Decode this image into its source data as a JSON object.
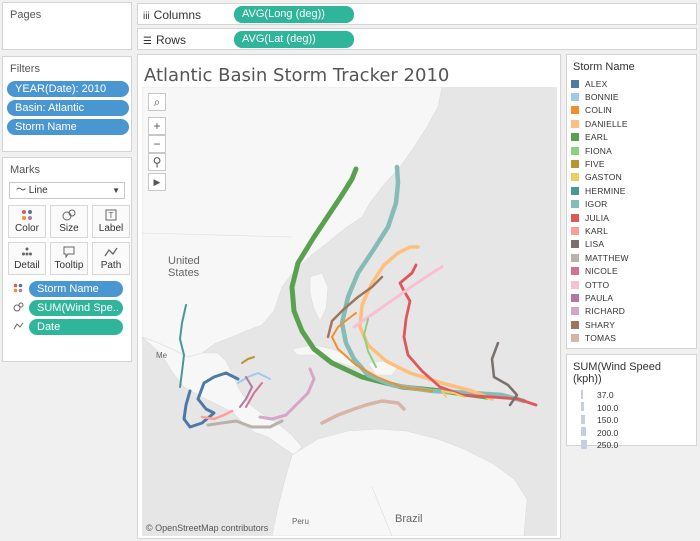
{
  "pages": {
    "title": "Pages"
  },
  "filters": {
    "title": "Filters",
    "items": [
      "YEAR(Date): 2010",
      "Basin: Atlantic",
      "Storm Name"
    ]
  },
  "marks": {
    "title": "Marks",
    "mark_type": "Line",
    "buttons": {
      "color": "Color",
      "size": "Size",
      "label": "Label",
      "detail": "Detail",
      "tooltip": "Tooltip",
      "path": "Path"
    },
    "fields": [
      "Storm Name",
      "SUM(Wind Spe..",
      "Date"
    ]
  },
  "shelves": {
    "columns_label": "Columns",
    "columns_pill": "AVG(Long (deg))",
    "rows_label": "Rows",
    "rows_pill": "AVG(Lat (deg))"
  },
  "view": {
    "title": "Atlantic Basin Storm Tracker 2010",
    "map_labels": {
      "us": "United States",
      "mexico": "Me",
      "peru": "Peru",
      "brazil": "Brazil"
    },
    "attribution": "© OpenStreetMap contributors"
  },
  "legend": {
    "title": "Storm Name",
    "items": [
      {
        "name": "ALEX",
        "color": "#4e79a7"
      },
      {
        "name": "BONNIE",
        "color": "#a0cbe8"
      },
      {
        "name": "COLIN",
        "color": "#f28e2b"
      },
      {
        "name": "DANIELLE",
        "color": "#ffbe7d"
      },
      {
        "name": "EARL",
        "color": "#59a14f"
      },
      {
        "name": "FIONA",
        "color": "#8cd17d"
      },
      {
        "name": "FIVE",
        "color": "#b6992d"
      },
      {
        "name": "GASTON",
        "color": "#f1ce63"
      },
      {
        "name": "HERMINE",
        "color": "#499894"
      },
      {
        "name": "IGOR",
        "color": "#86bcb6"
      },
      {
        "name": "JULIA",
        "color": "#e15759"
      },
      {
        "name": "KARL",
        "color": "#ff9d9a"
      },
      {
        "name": "LISA",
        "color": "#79706e"
      },
      {
        "name": "MATTHEW",
        "color": "#bab0ac"
      },
      {
        "name": "NICOLE",
        "color": "#d37295"
      },
      {
        "name": "OTTO",
        "color": "#fabfd2"
      },
      {
        "name": "PAULA",
        "color": "#b07aa1"
      },
      {
        "name": "RICHARD",
        "color": "#d4a6c8"
      },
      {
        "name": "SHARY",
        "color": "#9d7660"
      },
      {
        "name": "TOMAS",
        "color": "#d7b5a6"
      }
    ]
  },
  "size_legend": {
    "title": "SUM(Wind Speed (kph))",
    "items": [
      "37.0",
      "100.0",
      "150.0",
      "200.0",
      "250.0"
    ]
  }
}
